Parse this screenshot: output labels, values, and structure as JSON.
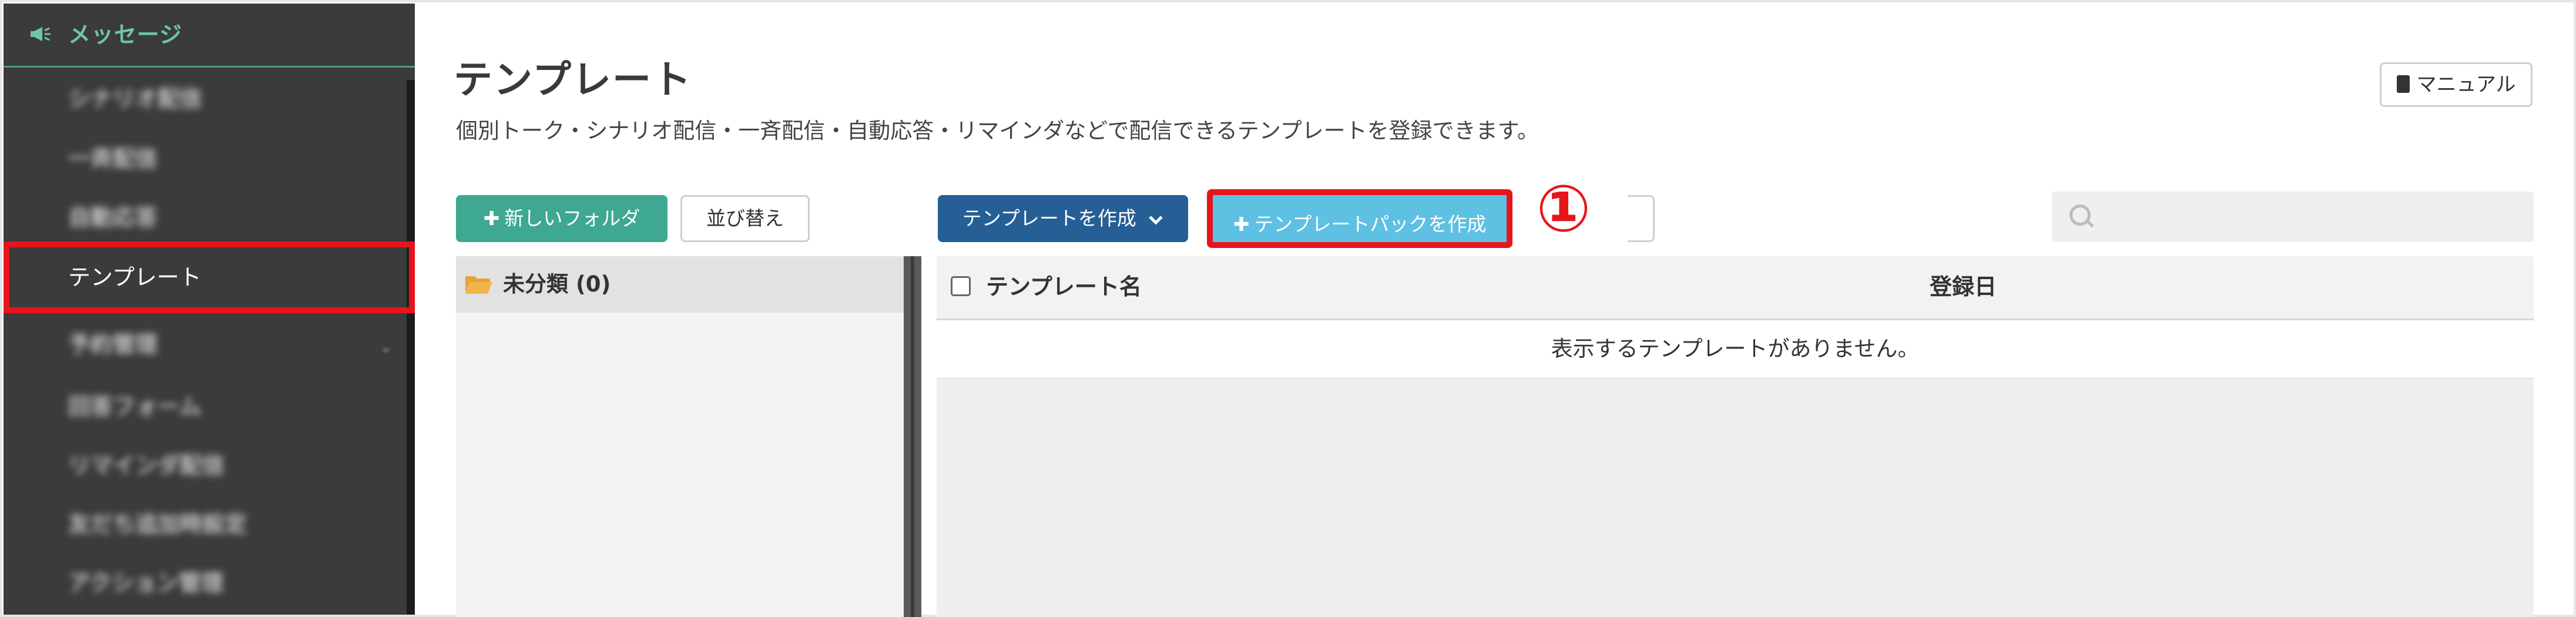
{
  "sidebar": {
    "section_title": "メッセージ",
    "items": [
      {
        "label": "シナリオ配信"
      },
      {
        "label": "一斉配信"
      },
      {
        "label": "自動応答"
      },
      {
        "label": "テンプレート"
      },
      {
        "label": "予約管理"
      },
      {
        "label": "回答フォーム"
      },
      {
        "label": "リマインダ配信"
      },
      {
        "label": "友だち追加時設定"
      },
      {
        "label": "アクション管理"
      }
    ]
  },
  "header": {
    "title": "テンプレート",
    "description": "個別トーク・シナリオ配信・一斉配信・自動応答・リマインダなどで配信できるテンプレートを登録できます。",
    "manual_label": "マニュアル"
  },
  "toolbar": {
    "new_folder_label": "新しいフォルダ",
    "sort_label": "並び替え",
    "create_template_label": "テンプレートを作成",
    "create_pack_label": "テンプレートパックを作成",
    "annotation": "①",
    "search_placeholder": ""
  },
  "folders": [
    {
      "label": "未分類 (0)"
    }
  ],
  "table": {
    "columns": [
      "テンプレート名",
      "登録日"
    ],
    "empty_message": "表示するテンプレートがありません。"
  },
  "colors": {
    "sidebar_bg": "#3b3b3b",
    "accent_green": "#3ea892",
    "primary_blue": "#265f96",
    "light_blue": "#5ec0e2",
    "highlight_red": "#e8141b"
  }
}
